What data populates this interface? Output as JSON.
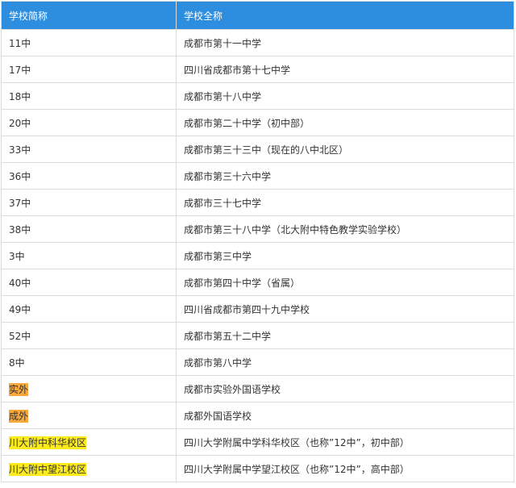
{
  "table": {
    "headers": [
      "学校简称",
      "学校全称"
    ],
    "rows": [
      {
        "short": "11中",
        "full": "成都市第十一中学",
        "highlight": ""
      },
      {
        "short": "17中",
        "full": "四川省成都市第十七中学",
        "highlight": ""
      },
      {
        "short": "18中",
        "full": "成都市第十八中学",
        "highlight": ""
      },
      {
        "short": "20中",
        "full": "成都市第二十中学（初中部）",
        "highlight": ""
      },
      {
        "short": "33中",
        "full": "成都市第三十三中（现在的八中北区）",
        "highlight": ""
      },
      {
        "short": "36中",
        "full": "成都市第三十六中学",
        "highlight": ""
      },
      {
        "short": "37中",
        "full": "成都市三十七中学",
        "highlight": ""
      },
      {
        "short": "38中",
        "full": "成都市第三十八中学（北大附中特色教学实验学校）",
        "highlight": ""
      },
      {
        "short": "3中",
        "full": "成都市第三中学",
        "highlight": ""
      },
      {
        "short": "40中",
        "full": "成都市第四十中学（省属）",
        "highlight": ""
      },
      {
        "short": "49中",
        "full": "四川省成都市第四十九中学校",
        "highlight": ""
      },
      {
        "short": "52中",
        "full": "成都市第五十二中学",
        "highlight": ""
      },
      {
        "short": "8中",
        "full": "成都市第八中学",
        "highlight": ""
      },
      {
        "short": "实外",
        "full": "成都市实验外国语学校",
        "highlight": "orange"
      },
      {
        "short": "成外",
        "full": "成都外国语学校",
        "highlight": "orange"
      },
      {
        "short": "川大附中科华校区",
        "full": "四川大学附属中学科华校区（也称”12中”，初中部）",
        "highlight": "yellow"
      },
      {
        "short": "川大附中望江校区",
        "full": "四川大学附属中学望江校区（也称”12中”，高中部）",
        "highlight": "yellow"
      }
    ]
  },
  "colors": {
    "header_bg": "#2d8ee0",
    "highlight_orange": "#f8a73a",
    "highlight_yellow": "#fbea1c"
  }
}
